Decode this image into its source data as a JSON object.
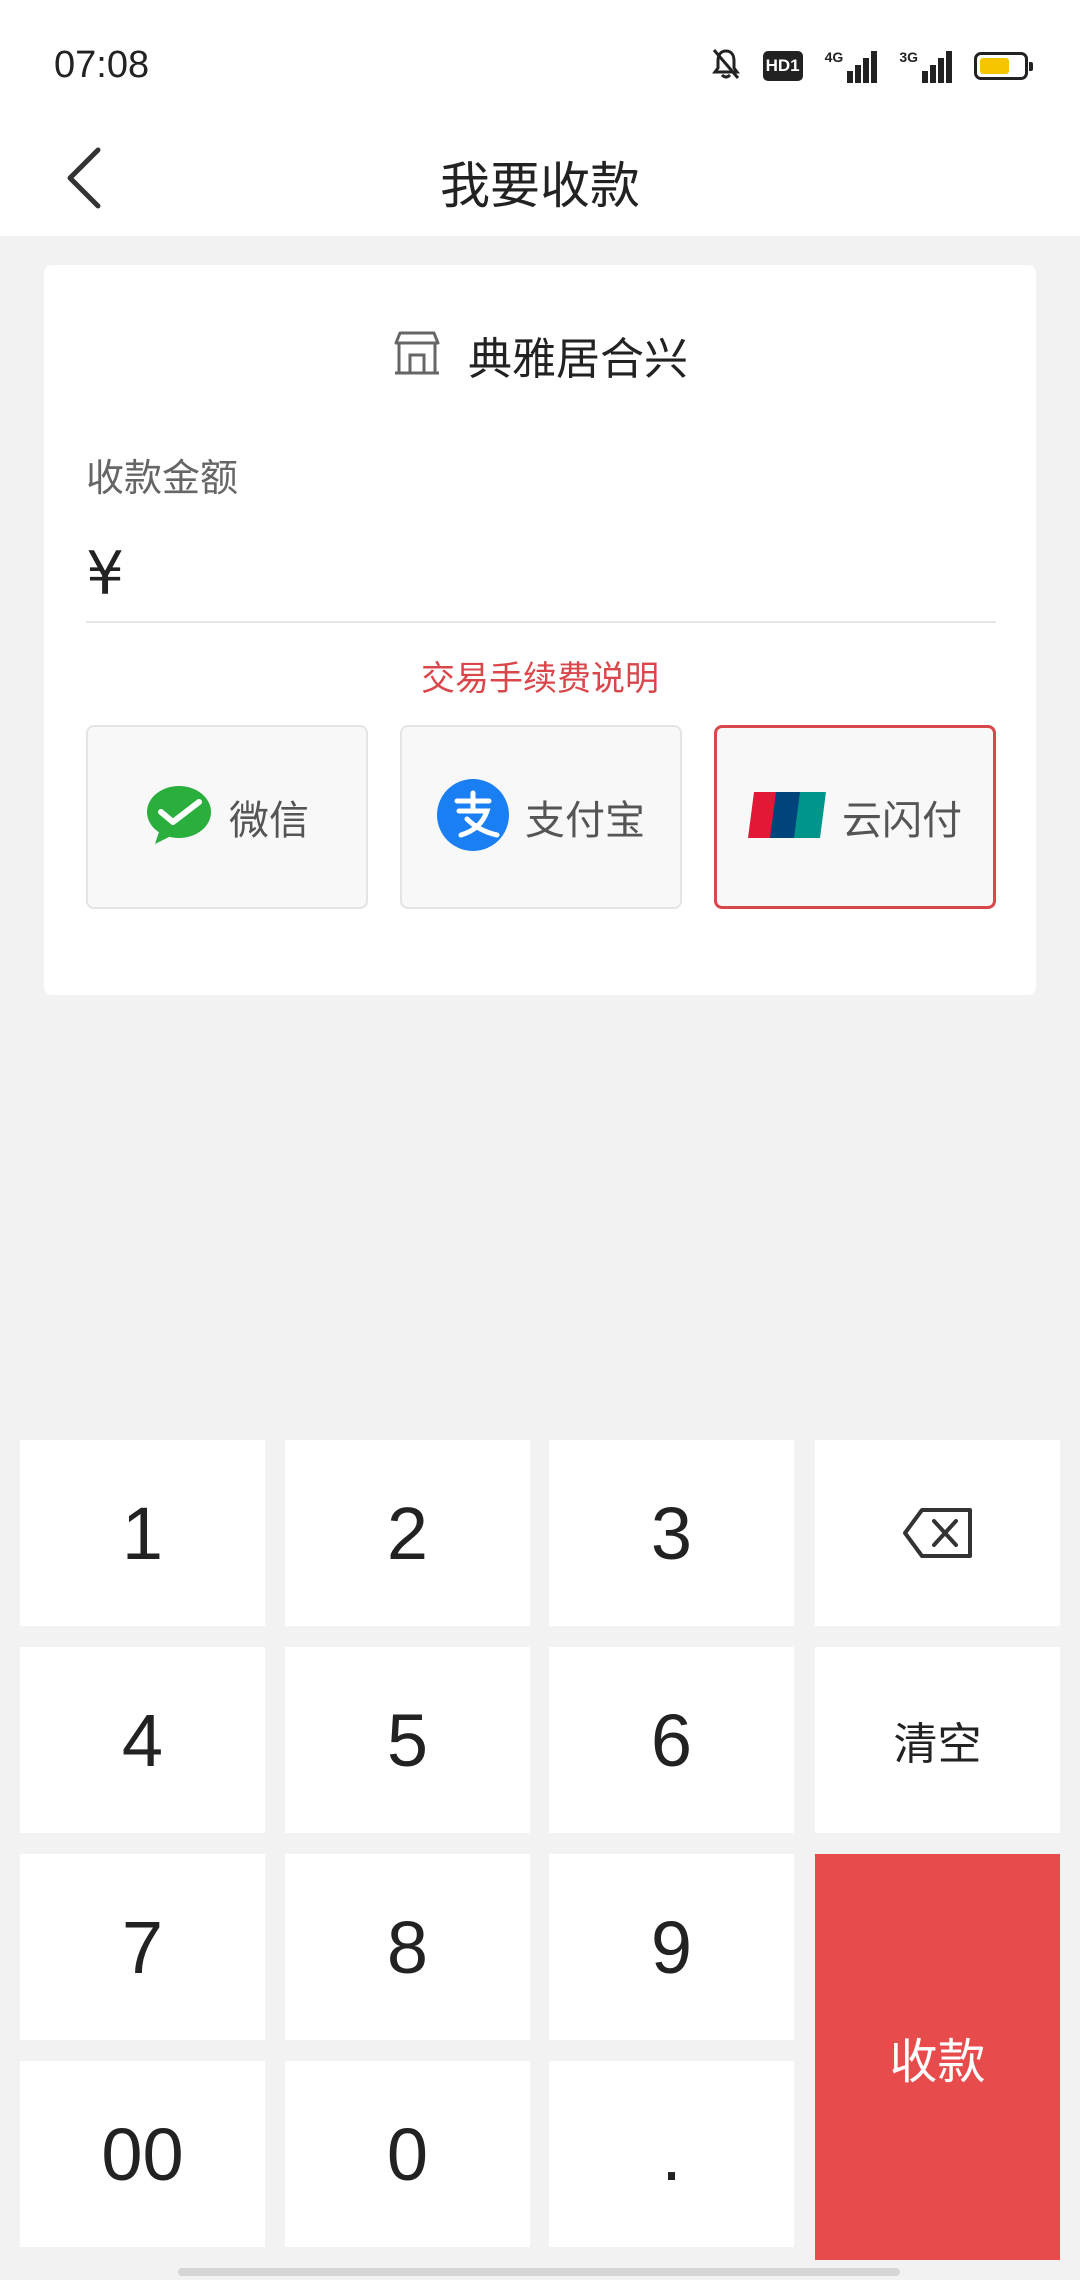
{
  "status_bar": {
    "time": "07:08",
    "hd_badge": "HD1",
    "network1": "4G",
    "network2": "3G",
    "icons": [
      "bell-off-icon",
      "hd-badge",
      "signal-4g-icon",
      "signal-3g-icon",
      "battery-icon"
    ],
    "battery_color": "#f6c500"
  },
  "header": {
    "title": "我要收款",
    "back_icon": "chevron-left-icon"
  },
  "card": {
    "merchant_icon": "shop-icon",
    "merchant_name": "典雅居合兴",
    "amount_label": "收款金额",
    "currency_symbol": "¥",
    "amount_value": "",
    "fee_link": "交易手续费说明",
    "pay_methods": [
      {
        "label": "微信",
        "icon": "wechat-icon",
        "selected": false
      },
      {
        "label": "支付宝",
        "icon": "alipay-icon",
        "selected": false
      },
      {
        "label": "云闪付",
        "icon": "unionpay-icon",
        "selected": true
      }
    ]
  },
  "keypad": {
    "keys": [
      "1",
      "2",
      "3",
      "4",
      "5",
      "6",
      "7",
      "8",
      "9",
      "00",
      "0",
      "."
    ],
    "backspace_icon": "backspace-icon",
    "clear_label": "清空",
    "collect_label": "收款"
  },
  "colors": {
    "accent": "#e84b4b",
    "link": "#d9474b",
    "background": "#f2f2f2"
  }
}
